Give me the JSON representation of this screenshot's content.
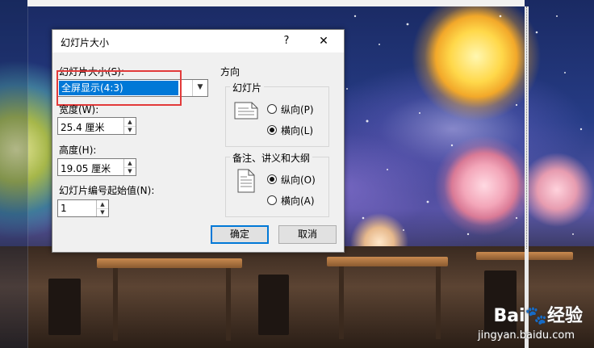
{
  "dialog": {
    "title": "幻灯片大小",
    "help": "?",
    "close": "✕",
    "size_label": "幻灯片大小(S):",
    "size_value": "全屏显示(4:3)",
    "width_label": "宽度(W):",
    "width_value": "25.4 厘米",
    "height_label": "高度(H):",
    "height_value": "19.05 厘米",
    "numbering_label": "幻灯片编号起始值(N):",
    "numbering_value": "1",
    "orientation_label": "方向",
    "slides_group": {
      "title": "幻灯片",
      "portrait": "纵向(P)",
      "landscape": "横向(L)",
      "selected": "landscape"
    },
    "notes_group": {
      "title": "备注、讲义和大纲",
      "portrait": "纵向(O)",
      "landscape": "横向(A)",
      "selected": "portrait"
    },
    "ok": "确定",
    "cancel": "取消"
  },
  "watermark": {
    "logo": "Bai🐾经验",
    "url": "jingyan.baidu.com"
  },
  "colors": {
    "accent": "#0078d7",
    "highlight_box": "#e23a3a"
  }
}
